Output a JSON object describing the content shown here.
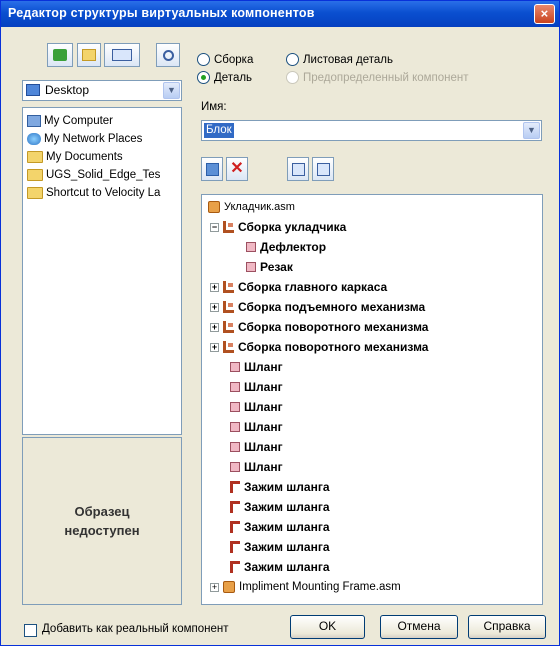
{
  "title": "Редактор структуры виртуальных компонентов",
  "close_glyph": "×",
  "browser": {
    "location": "Desktop",
    "items": [
      "My Computer",
      "My Network Places",
      "My Documents",
      "UGS_Solid_Edge_Tes",
      "Shortcut to Velocity La"
    ]
  },
  "preview": {
    "line1": "Образец",
    "line2": "недоступен"
  },
  "type_options": {
    "assembly": "Сборка",
    "sheet_part": "Листовая деталь",
    "part": "Деталь",
    "predefined": "Предопределенный компонент"
  },
  "name_label": "Имя:",
  "name_value": "Блок",
  "tree": {
    "root": "Укладчик.asm",
    "rows": [
      "Сборка укладчика",
      "Дефлектор",
      "Резак",
      "Сборка главного каркаса",
      "Сборка подъемного механизма",
      "Сборка поворотного механизма",
      "Сборка поворотного механизма",
      "Шланг",
      "Шланг",
      "Шланг",
      "Шланг",
      "Шланг",
      "Шланг",
      "Зажим шланга",
      "Зажим шланга",
      "Зажим шланга",
      "Зажим шланга",
      "Зажим шланга",
      "Impliment Mounting Frame.asm"
    ]
  },
  "footer": {
    "add_as_real": "Добавить как реальный компонент",
    "ok": "OK",
    "cancel": "Отмена",
    "help": "Справка"
  }
}
